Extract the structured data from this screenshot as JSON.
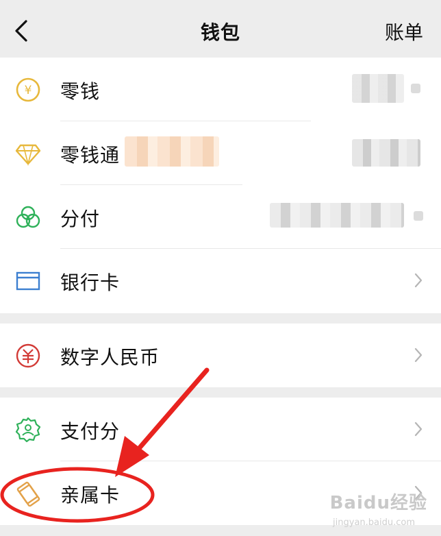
{
  "nav": {
    "title": "钱包",
    "right_label": "账单"
  },
  "wallet": {
    "items": [
      {
        "label": "零钱",
        "icon": "yuan-coin-icon",
        "color": "#e7b83b"
      },
      {
        "label": "零钱通",
        "icon": "diamond-icon",
        "color": "#e7b83b"
      },
      {
        "label": "分付",
        "icon": "fenfu-circles-icon",
        "color": "#2fb15a"
      },
      {
        "label": "银行卡",
        "icon": "bank-card-icon",
        "color": "#3c7fd0"
      }
    ]
  },
  "digital": {
    "items": [
      {
        "label": "数字人民币",
        "icon": "digital-rmb-icon",
        "color": "#d23a36"
      }
    ]
  },
  "services": {
    "items": [
      {
        "label": "支付分",
        "icon": "pay-score-icon",
        "color": "#2fb15a"
      },
      {
        "label": "亲属卡",
        "icon": "family-card-icon",
        "color": "#e3a24a"
      }
    ]
  },
  "watermark": {
    "brand": "Baidu经验",
    "url": "jingyan.baidu.com"
  },
  "colors": {
    "accent_red": "#e8231f",
    "divider": "#e8e8e8",
    "chevron": "#b5b5b5"
  }
}
